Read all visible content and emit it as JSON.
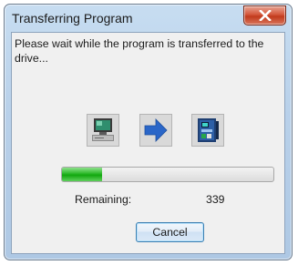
{
  "dialog": {
    "title": "Transferring Program",
    "close_icon": "close-icon",
    "message": "Please wait while the program is transferred to the drive...",
    "icons": {
      "source": "computer-icon",
      "arrow": "arrow-right-icon",
      "target": "drive-icon"
    },
    "progress": {
      "fraction": 0.19
    },
    "remaining_label": "Remaining:",
    "remaining_value": "339",
    "cancel_label": "Cancel"
  },
  "colors": {
    "progress_green": "#1fb21c",
    "arrow_blue": "#2a66c8",
    "close_red": "#c13a1c"
  }
}
